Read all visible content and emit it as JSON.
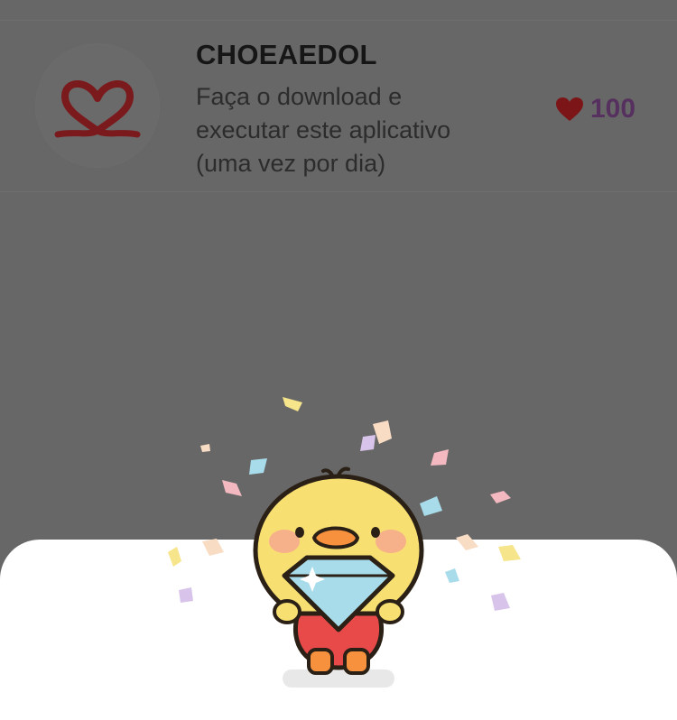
{
  "app_item": {
    "name": "CHOEAEDOL",
    "description_lines": [
      "Faça o download e",
      "executar este aplicativo",
      "(uma vez por dia)"
    ],
    "reward_value": "100",
    "logo_icon": "double-heart-ribbon-logo-icon",
    "reward_icon": "heart-icon"
  },
  "celebration": {
    "mascot_icon": "duck-holding-diamond-icon",
    "decoration": "confetti"
  },
  "colors": {
    "overlay": "#676767",
    "logo_red": "#7a1a1c",
    "heart_red": "#7c1518",
    "reward_purple": "#56305e",
    "sheet": "#ffffff"
  }
}
